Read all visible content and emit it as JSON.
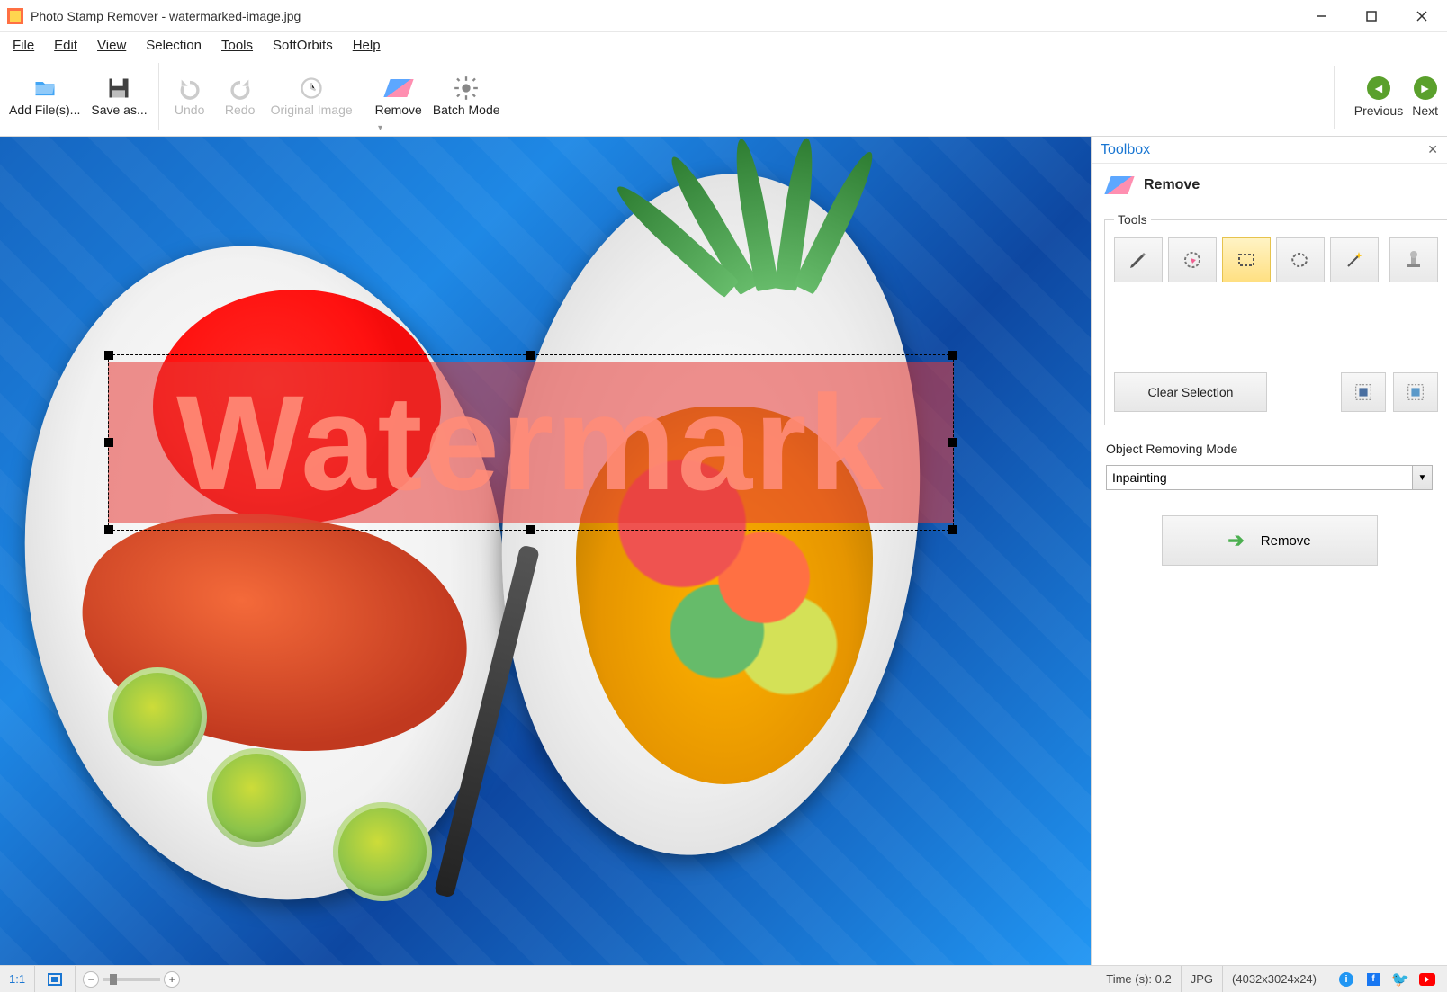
{
  "titlebar": {
    "app_name": "Photo Stamp Remover",
    "document": "watermarked-image.jpg",
    "full_title": "Photo Stamp Remover - watermarked-image.jpg"
  },
  "menubar": {
    "file": "File",
    "edit": "Edit",
    "view": "View",
    "selection": "Selection",
    "tools": "Tools",
    "softorbits": "SoftOrbits",
    "help": "Help"
  },
  "toolbar": {
    "add_files": "Add File(s)...",
    "save_as": "Save as...",
    "undo": "Undo",
    "redo": "Redo",
    "original_image": "Original Image",
    "remove": "Remove",
    "batch_mode": "Batch Mode",
    "previous": "Previous",
    "next": "Next"
  },
  "canvas": {
    "watermark_text": "Watermark"
  },
  "toolbox": {
    "title": "Toolbox",
    "mode": "Remove",
    "tools_legend": "Tools",
    "clear_selection": "Clear Selection",
    "object_removing_mode_label": "Object Removing Mode",
    "object_removing_mode_value": "Inpainting",
    "remove_button": "Remove"
  },
  "statusbar": {
    "ratio": "1:1",
    "time_label": "Time (s): 0.2",
    "format": "JPG",
    "dimensions": "(4032x3024x24)"
  }
}
